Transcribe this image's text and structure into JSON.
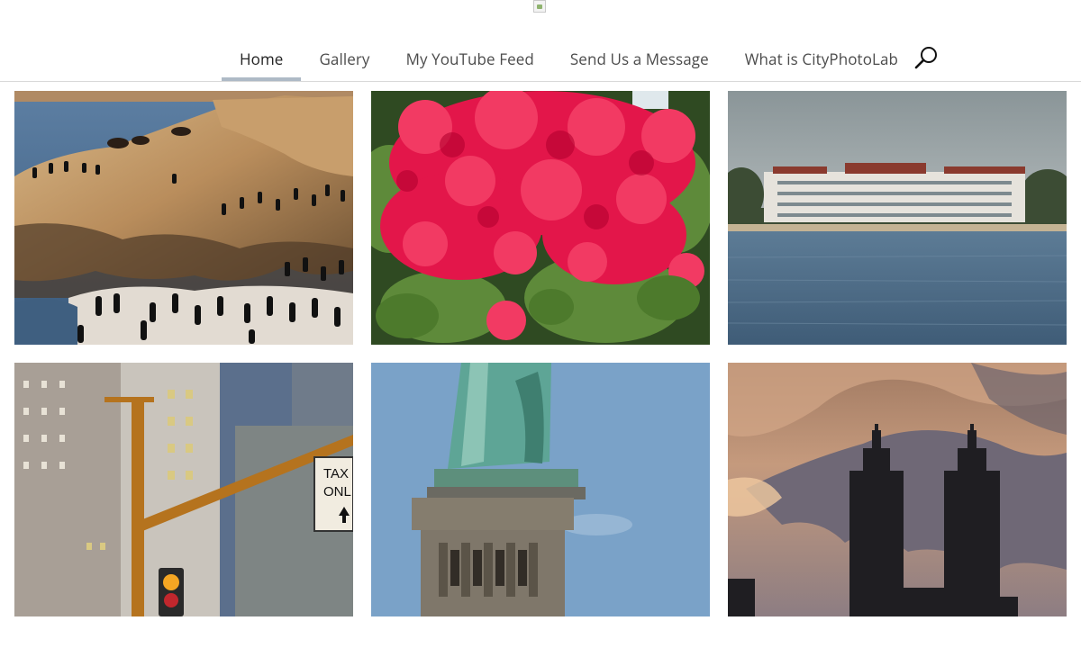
{
  "header": {
    "logo_icon": "broken-image-icon"
  },
  "nav": {
    "items": [
      {
        "label": "Home",
        "active": true
      },
      {
        "label": "Gallery",
        "active": false
      },
      {
        "label": "My YouTube Feed",
        "active": false
      },
      {
        "label": "Send Us a Message",
        "active": false
      },
      {
        "label": "What is CityPhotoLab",
        "active": false
      }
    ],
    "search_icon": "search-icon",
    "active_indicator_color": "#aebac6"
  },
  "gallery": {
    "photos": [
      {
        "subject": "sea lions and cormorants on rocks"
      },
      {
        "subject": "red bougainvillea flowers"
      },
      {
        "subject": "waterfront building across the bay"
      },
      {
        "subject": "city street with traffic light"
      },
      {
        "subject": "statue of liberty pedestal"
      },
      {
        "subject": "twin tower skyline at sunset"
      }
    ],
    "sign_text": [
      "TAX",
      "ONL"
    ]
  }
}
